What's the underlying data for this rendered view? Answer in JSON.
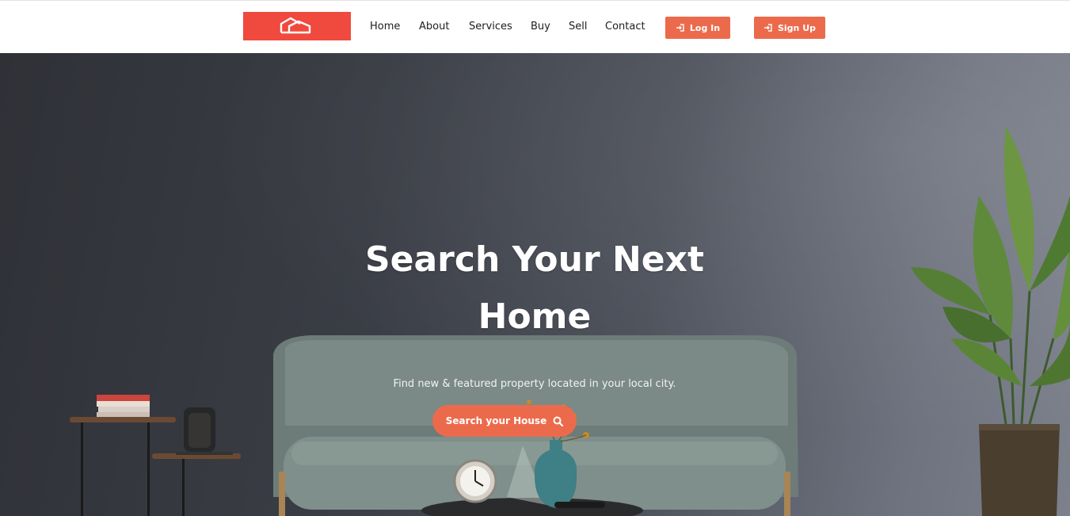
{
  "brand": {
    "logo_icon": "house-outline-logo",
    "color": "#f04a3e"
  },
  "nav": {
    "links": [
      "Home",
      "About",
      "Services",
      "Buy",
      "Sell",
      "Contact"
    ],
    "login_label": "Log In",
    "signup_label": "Sign Up",
    "login_icon": "sign-in-icon",
    "signup_icon": "sign-in-icon",
    "button_color": "#ec6a4c"
  },
  "hero": {
    "title_line1": "Search Your Next",
    "title_line2": "Home",
    "subtitle": "Find new & featured property located in your local city.",
    "cta_label": "Search your House",
    "cta_icon": "search-icon"
  }
}
